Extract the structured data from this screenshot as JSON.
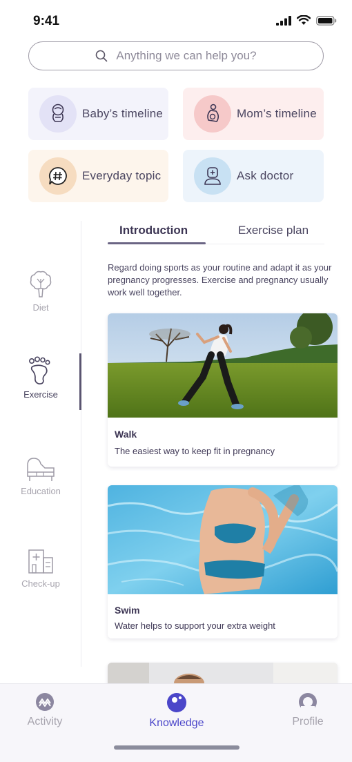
{
  "status": {
    "time": "9:41"
  },
  "search": {
    "placeholder": "Anything we can help you?"
  },
  "quick_cards": [
    {
      "label": "Baby’s timeline",
      "icon": "baby-icon",
      "bg": "#f3f3fb",
      "circle": "#e3e2f6"
    },
    {
      "label": "Mom’s timeline",
      "icon": "pregnant-mom-icon",
      "bg": "#fdeeee",
      "circle": "#f6c9c9"
    },
    {
      "label": "Everyday topic",
      "icon": "hashtag-chat-icon",
      "bg": "#fdf5ec",
      "circle": "#f6dcc0"
    },
    {
      "label": "Ask doctor",
      "icon": "doctor-icon",
      "bg": "#edf4fb",
      "circle": "#c8e1f3"
    }
  ],
  "sidebar": {
    "items": [
      {
        "label": "Diet",
        "icon": "broccoli-icon",
        "active": false
      },
      {
        "label": "Exercise",
        "icon": "footprint-icon",
        "active": true
      },
      {
        "label": "Education",
        "icon": "piano-icon",
        "active": false
      },
      {
        "label": "Check-up",
        "icon": "hospital-icon",
        "active": false
      }
    ]
  },
  "tabs": [
    {
      "label": "Introduction",
      "active": true
    },
    {
      "label": "Exercise plan",
      "active": false
    }
  ],
  "intro_text": "Regard doing sports as your routine and adapt it as your pregnancy progresses. Exercise and pregnancy usually work well together.",
  "exercises": [
    {
      "title": "Walk",
      "description": "The easiest way to keep fit in pregnancy",
      "image": "pregnant-woman-walking-photo"
    },
    {
      "title": "Swim",
      "description": "Water helps to support your extra weight",
      "image": "pregnant-woman-swimming-photo"
    }
  ],
  "bottom_nav": [
    {
      "label": "Activity",
      "icon": "activity-icon",
      "active": false
    },
    {
      "label": "Knowledge",
      "icon": "knowledge-icon",
      "active": true
    },
    {
      "label": "Profile",
      "icon": "profile-icon",
      "active": false
    }
  ],
  "colors": {
    "accent": "#4b46c9",
    "text": "#4a4560",
    "muted": "#a7a4ae"
  }
}
